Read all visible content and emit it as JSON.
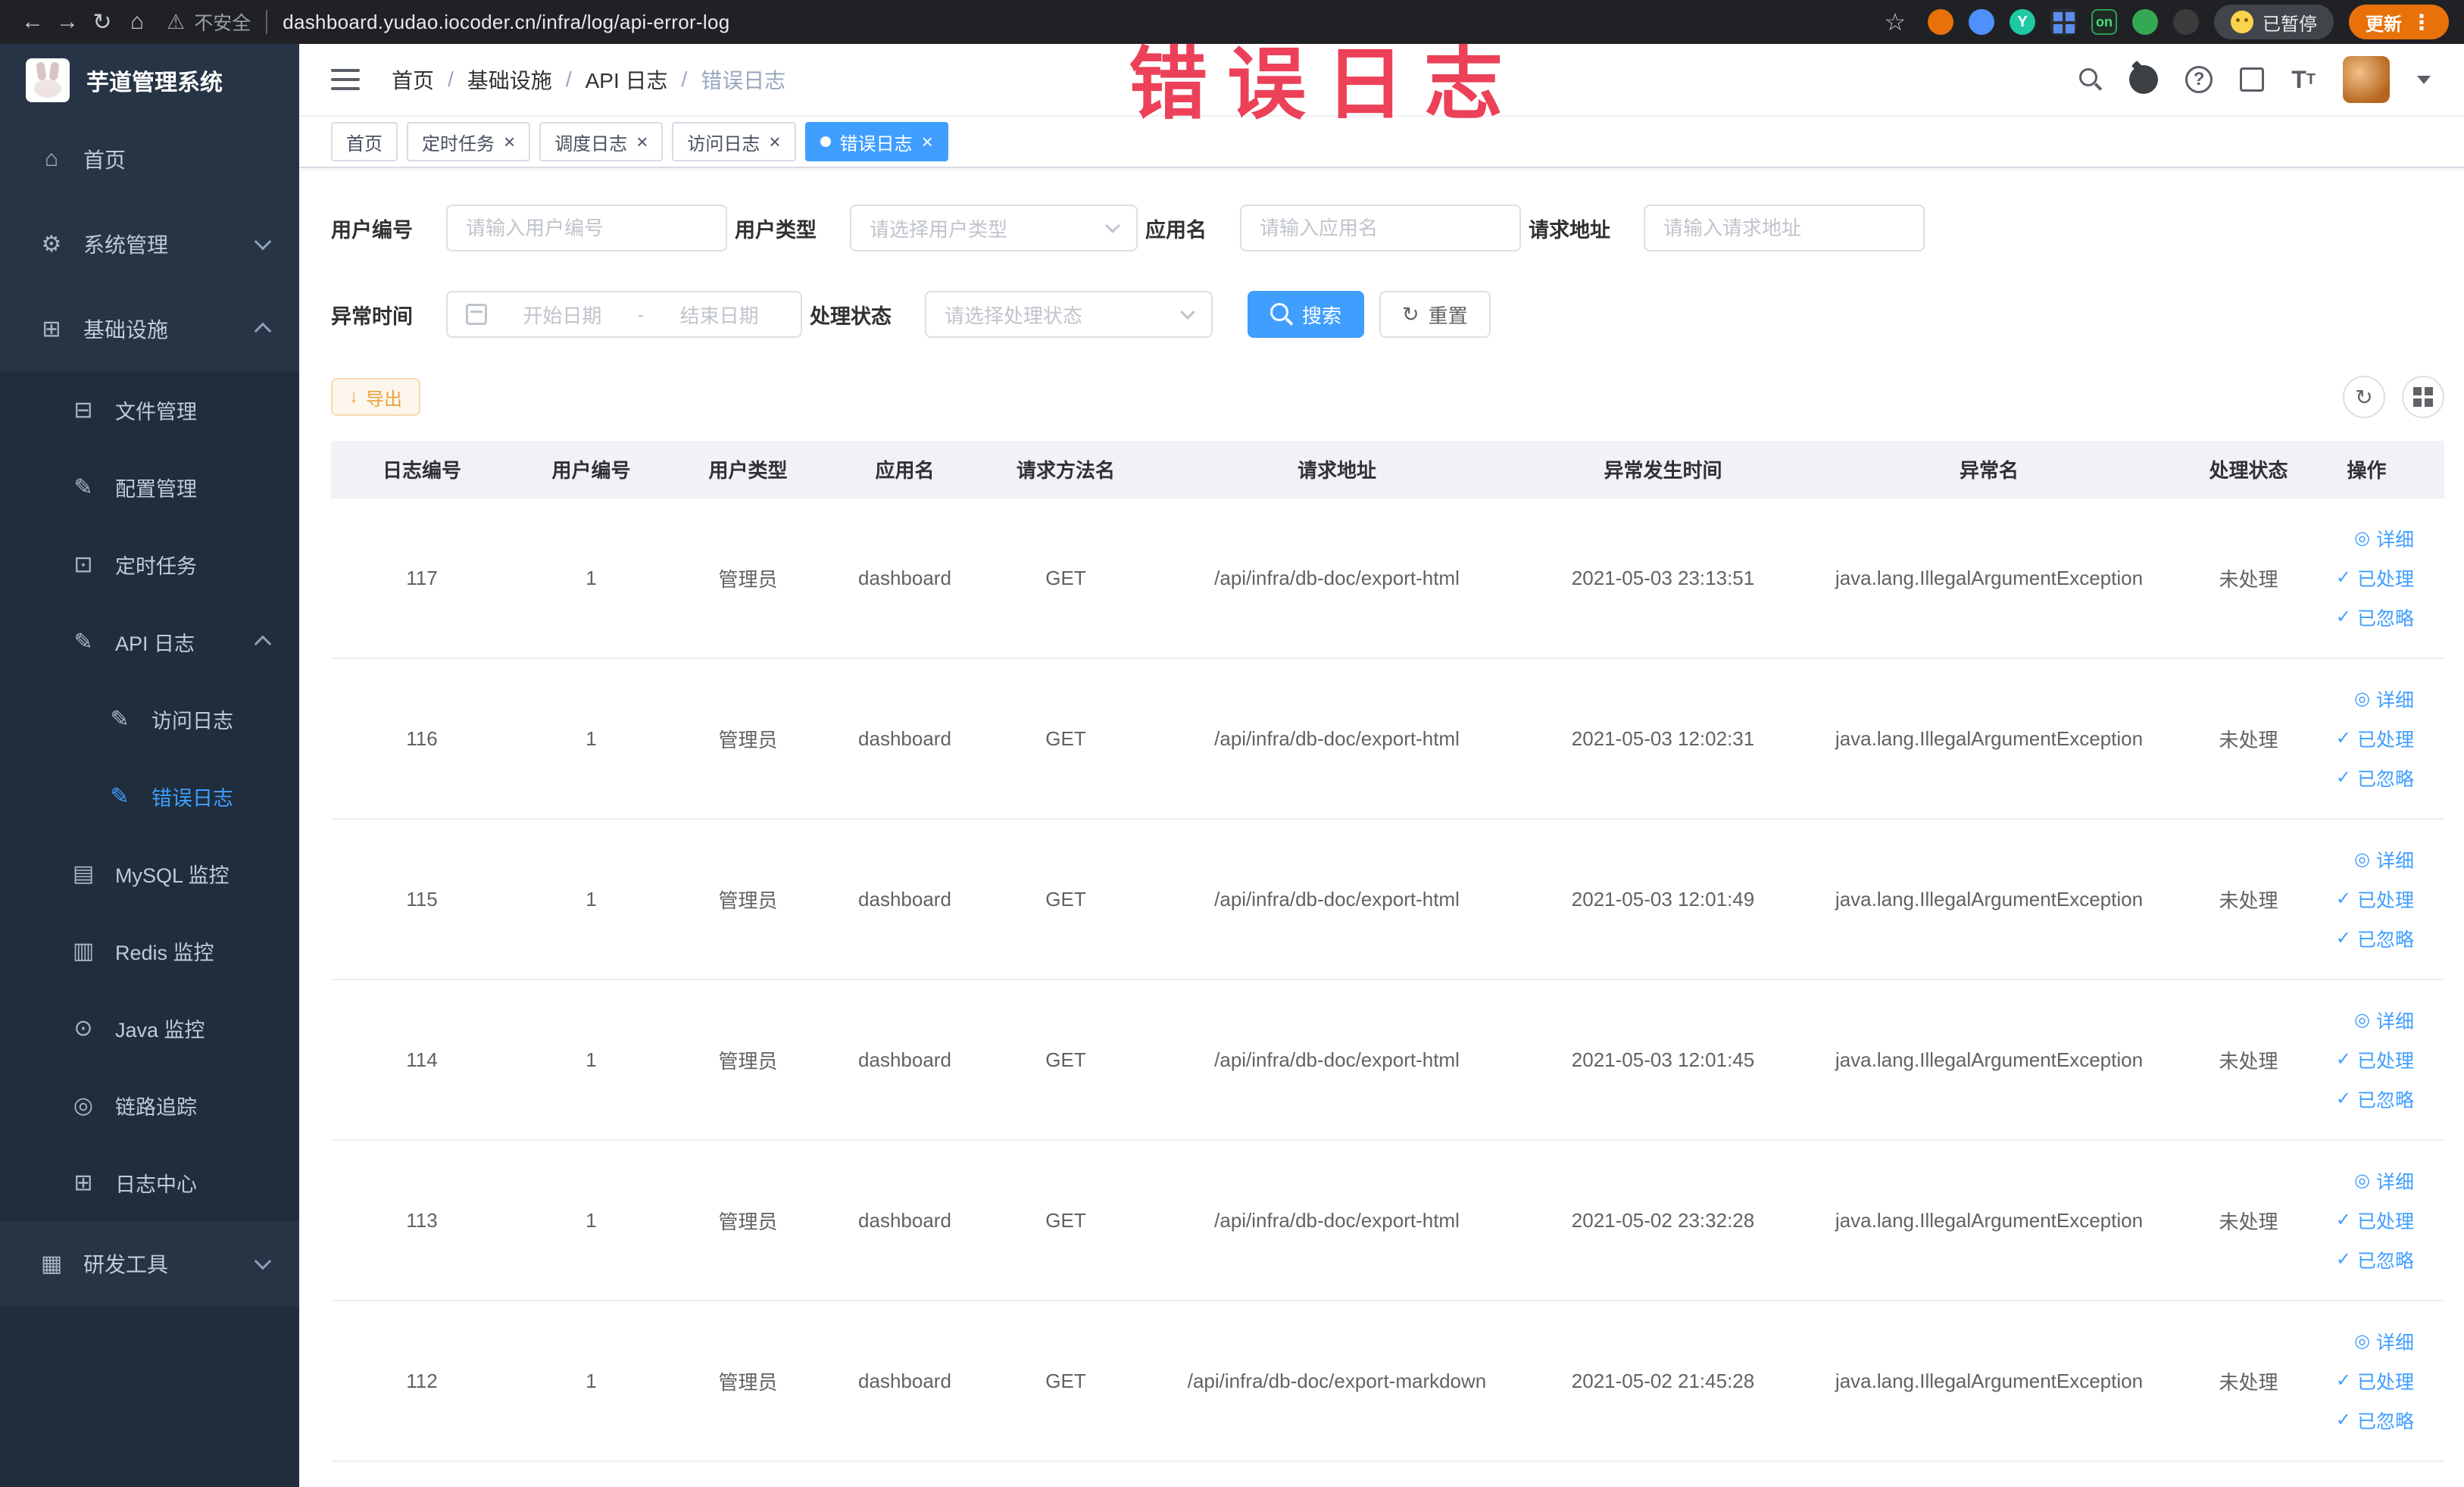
{
  "annotation": {
    "text": "错误日志"
  },
  "browser": {
    "security_warning": "不安全",
    "url": "dashboard.yudao.iocoder.cn/infra/log/api-error-log",
    "on_badge": "on",
    "paused_label": "已暂停",
    "update_label": "更新"
  },
  "sidebar": {
    "logo_title": "芋道管理系统",
    "home": "首页",
    "system": "系统管理",
    "infra": "基础设施",
    "infra_items": {
      "file": "文件管理",
      "config": "配置管理",
      "job": "定时任务",
      "api_log": "API 日志",
      "access_log": "访问日志",
      "error_log": "错误日志",
      "mysql": "MySQL 监控",
      "redis": "Redis 监控",
      "java": "Java 监控",
      "trace": "链路追踪",
      "log_center": "日志中心"
    },
    "dev_tools": "研发工具"
  },
  "header": {
    "breadcrumb": [
      "首页",
      "基础设施",
      "API 日志",
      "错误日志"
    ]
  },
  "tabs": [
    "首页",
    "定时任务",
    "调度日志",
    "访问日志",
    "错误日志"
  ],
  "filters": {
    "user_id": {
      "label": "用户编号",
      "placeholder": "请输入用户编号"
    },
    "user_type": {
      "label": "用户类型",
      "placeholder": "请选择用户类型"
    },
    "app_name": {
      "label": "应用名",
      "placeholder": "请输入应用名"
    },
    "request_url": {
      "label": "请求地址",
      "placeholder": "请输入请求地址"
    },
    "exception_time": {
      "label": "异常时间",
      "start_placeholder": "开始日期",
      "separator": "-",
      "end_placeholder": "结束日期"
    },
    "process_status": {
      "label": "处理状态",
      "placeholder": "请选择处理状态"
    },
    "search_label": "搜索",
    "reset_label": "重置"
  },
  "toolbar": {
    "export_label": "导出"
  },
  "table": {
    "columns": [
      "日志编号",
      "用户编号",
      "用户类型",
      "应用名",
      "请求方法名",
      "请求地址",
      "异常发生时间",
      "异常名",
      "处理状态",
      "操作"
    ],
    "actions": [
      "详细",
      "已处理",
      "已忽略"
    ],
    "rows": [
      {
        "id": "117",
        "user_id": "1",
        "user_type": "管理员",
        "app": "dashboard",
        "method": "GET",
        "url": "/api/infra/db-doc/export-html",
        "time": "2021-05-03 23:13:51",
        "exception": "java.lang.IllegalArgumentException",
        "status": "未处理"
      },
      {
        "id": "116",
        "user_id": "1",
        "user_type": "管理员",
        "app": "dashboard",
        "method": "GET",
        "url": "/api/infra/db-doc/export-html",
        "time": "2021-05-03 12:02:31",
        "exception": "java.lang.IllegalArgumentException",
        "status": "未处理"
      },
      {
        "id": "115",
        "user_id": "1",
        "user_type": "管理员",
        "app": "dashboard",
        "method": "GET",
        "url": "/api/infra/db-doc/export-html",
        "time": "2021-05-03 12:01:49",
        "exception": "java.lang.IllegalArgumentException",
        "status": "未处理"
      },
      {
        "id": "114",
        "user_id": "1",
        "user_type": "管理员",
        "app": "dashboard",
        "method": "GET",
        "url": "/api/infra/db-doc/export-html",
        "time": "2021-05-03 12:01:45",
        "exception": "java.lang.IllegalArgumentException",
        "status": "未处理"
      },
      {
        "id": "113",
        "user_id": "1",
        "user_type": "管理员",
        "app": "dashboard",
        "method": "GET",
        "url": "/api/infra/db-doc/export-html",
        "time": "2021-05-02 23:32:28",
        "exception": "java.lang.IllegalArgumentException",
        "status": "未处理"
      },
      {
        "id": "112",
        "user_id": "1",
        "user_type": "管理员",
        "app": "dashboard",
        "method": "GET",
        "url": "/api/infra/db-doc/export-markdown",
        "time": "2021-05-02 21:45:28",
        "exception": "java.lang.IllegalArgumentException",
        "status": "未处理"
      }
    ]
  },
  "colors": {
    "accent": "#409EFF",
    "warning": "#e6a23c",
    "sidebar_bg": "#263445",
    "submenu_bg": "#1f2d3d",
    "annotation_red": "#ec4158"
  }
}
